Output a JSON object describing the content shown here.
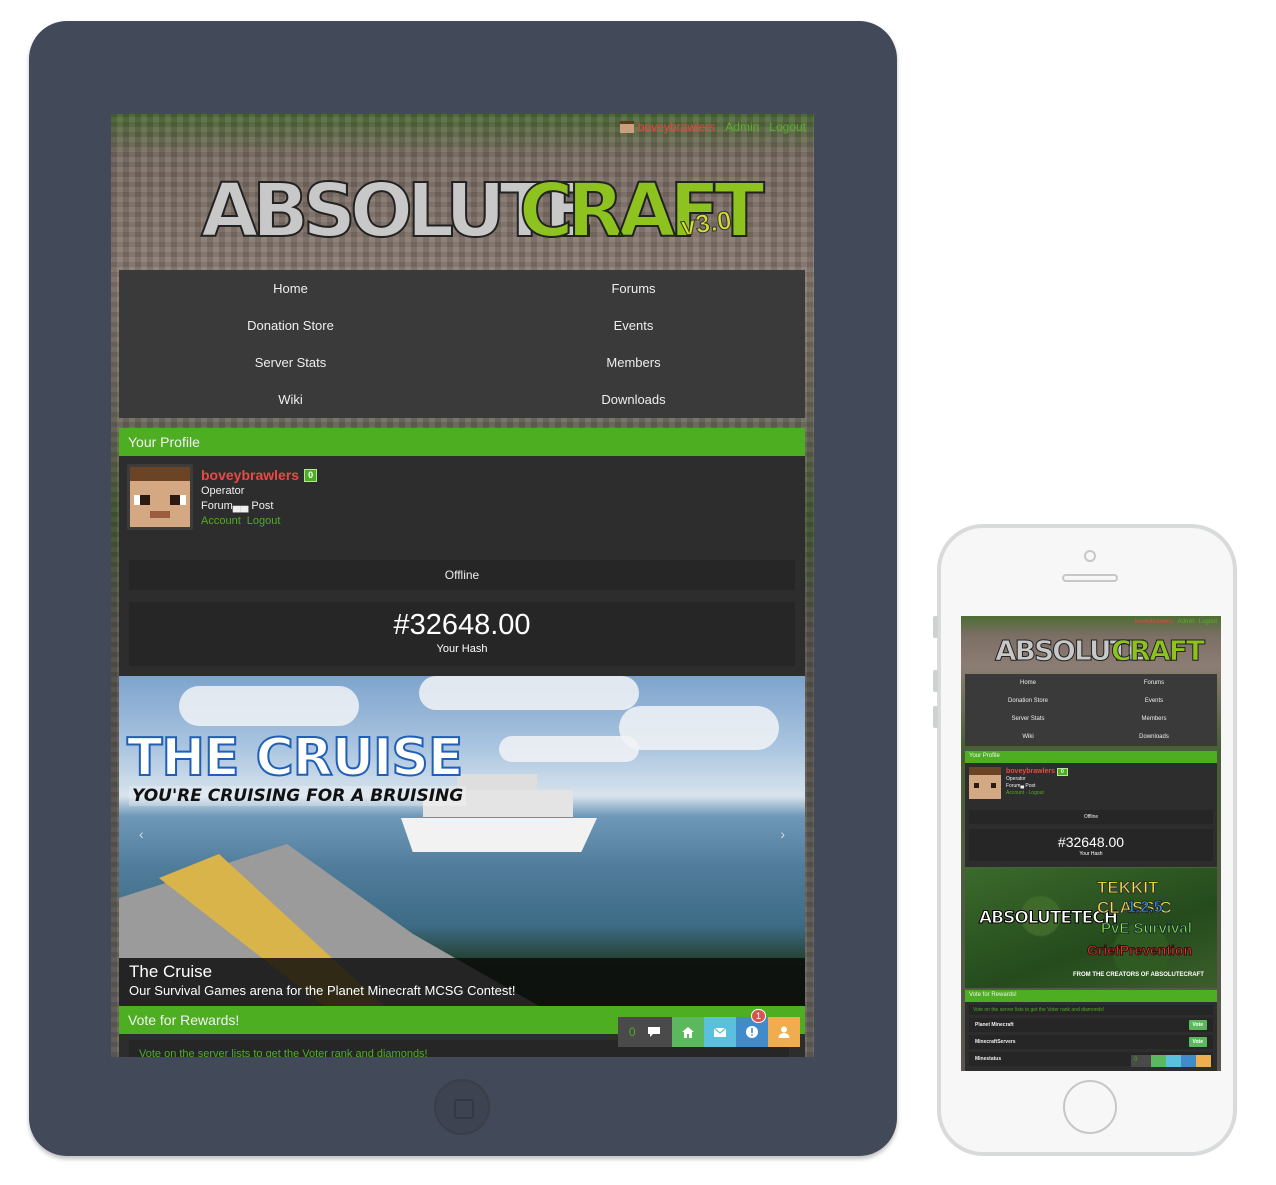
{
  "tablet": {
    "topbar": {
      "username": "boveybrawlers",
      "admin": "Admin",
      "logout": "Logout"
    },
    "logo": {
      "word_a": "ABSOLUTE",
      "word_b": "CRAFT",
      "version": "v3.0"
    },
    "nav": [
      "Home",
      "Forums",
      "Donation Store",
      "Events",
      "Server Stats",
      "Members",
      "Wiki",
      "Downloads"
    ],
    "profile": {
      "heading": "Your Profile",
      "username": "boveybrawlers",
      "badge": "0",
      "rank": "Operator",
      "posts": "Forum▄▄ Post",
      "account_link": "Account",
      "logout_link": "Logout",
      "status": "Offline",
      "hash_value": "#32648.00",
      "hash_label": "Your Hash"
    },
    "banner": {
      "art_title": "THE CRUISE",
      "art_subtitle": "YOU'RE CRUISING FOR A BRUISING",
      "caption_title": "The Cruise",
      "caption_text": "Our Survival Games arena for the Planet Minecraft MCSG Contest!"
    },
    "vote": {
      "heading": "Vote for Rewards!",
      "text": "Vote on the server lists to get the Voter rank and diamonds!"
    },
    "dock": {
      "chat_count": "0",
      "notification_count": "1"
    }
  },
  "phone": {
    "topbar": {
      "username": "boveybrawlers",
      "admin": "Admin",
      "logout": "Logout"
    },
    "logo": {
      "word_a": "ABSOLUTE",
      "word_b": "CRAFT"
    },
    "nav": [
      "Home",
      "Forums",
      "Donation Store",
      "Events",
      "Server Stats",
      "Members",
      "Wiki",
      "Downloads"
    ],
    "profile": {
      "heading": "Your Profile",
      "username": "boveybrawlers",
      "badge": "0",
      "rank": "Operator",
      "posts": "Forum▄ Post",
      "links": "Account · Logout",
      "status": "Offline",
      "hash_value": "#32648.00",
      "hash_label": "Your Hash"
    },
    "banner": {
      "brand": "ABSOLUTETECH",
      "line1": "TEKKIT CLASSIC",
      "line2": "1.2.5",
      "line3": "PvE Survival",
      "line4": "GriefPrevention",
      "footer": "FROM THE CREATORS OF ABSOLUTECRAFT"
    },
    "vote": {
      "heading": "Vote for Rewards!",
      "text": "Vote on the server lists to get the Voter rank and diamonds!",
      "rows": [
        {
          "name": "Planet Minecraft",
          "button": "Vote"
        },
        {
          "name": "MinecraftServers",
          "button": "Vote"
        },
        {
          "name": "Minestatus",
          "button": ""
        }
      ]
    },
    "dock": {
      "chat_count": "0"
    }
  }
}
